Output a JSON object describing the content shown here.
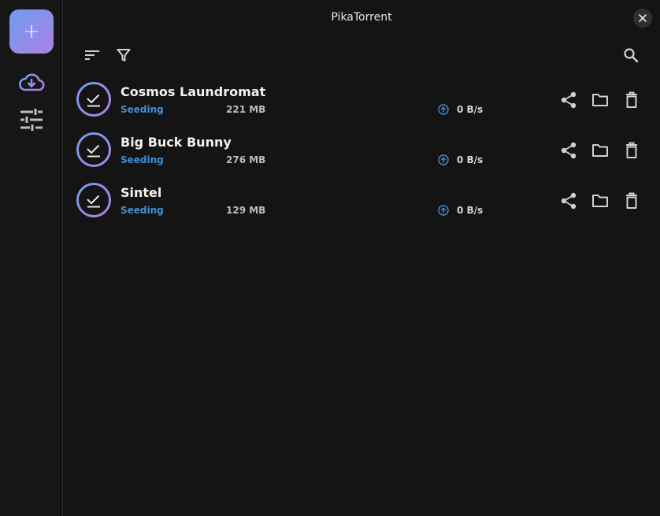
{
  "window": {
    "title": "PikaTorrent"
  },
  "sidebar": {
    "add_label": "+",
    "items": [
      {
        "icon": "cloud-download-icon"
      },
      {
        "icon": "tune-sliders-icon"
      }
    ]
  },
  "toolbar": {
    "icons": [
      "sort-icon",
      "filter-icon",
      "search-icon"
    ]
  },
  "colors": {
    "accent_gradient_start": "#6f9cf4",
    "accent_gradient_end": "#a982e0",
    "status_seeding": "#3f8fd8",
    "background": "#141414"
  },
  "torrents": [
    {
      "name": "Cosmos Laundromat",
      "status": "Seeding",
      "size": "221 MB",
      "upload_speed": "0 B/s"
    },
    {
      "name": "Big Buck Bunny",
      "status": "Seeding",
      "size": "276 MB",
      "upload_speed": "0 B/s"
    },
    {
      "name": "Sintel",
      "status": "Seeding",
      "size": "129 MB",
      "upload_speed": "0 B/s"
    }
  ]
}
